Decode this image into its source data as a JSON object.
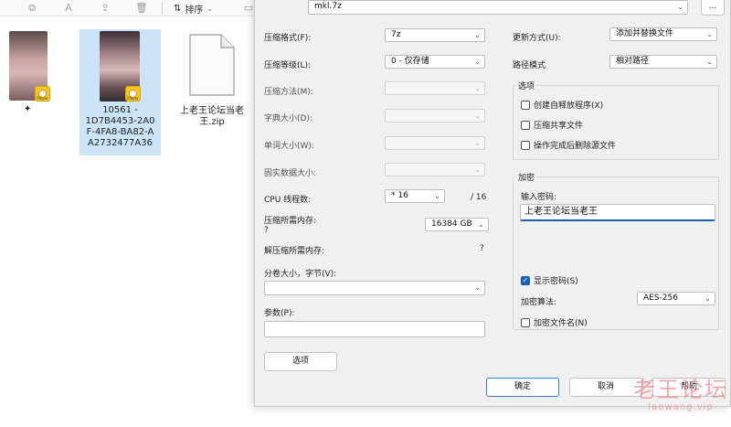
{
  "toolbar": {
    "sort_label": "排序",
    "icons": [
      "copy-icon",
      "rename-icon",
      "share-icon",
      "delete-icon"
    ]
  },
  "files": [
    {
      "name": "",
      "badge_text": "Player",
      "star_icon": "✦"
    },
    {
      "name": "10561 - 1D7B4453-2A0F-4FA8-BA82-AA2732477A36",
      "badge_text": "Player",
      "lines": [
        "10561 -",
        "1D7B4453-2A0",
        "F-4FA8-BA82-A",
        "A2732477A36"
      ]
    },
    {
      "name": "上老王论坛当老王.zip",
      "lines": [
        "上老王论坛当老",
        "王.zip"
      ]
    }
  ],
  "dialog": {
    "archive_field": {
      "value": "mkl.7z",
      "browse_label": "..."
    },
    "left": {
      "format": {
        "label": "压缩格式(F):",
        "value": "7z"
      },
      "level": {
        "label": "压缩等级(L):",
        "value": "0 - 仅存储"
      },
      "method": {
        "label": "压缩方法(M):",
        "value": ""
      },
      "dict": {
        "label": "字典大小(D):",
        "value": ""
      },
      "word": {
        "label": "单词大小(W):",
        "value": ""
      },
      "solid": {
        "label": "固实数据大小:",
        "value": ""
      },
      "cpu": {
        "label": "CPU 线程数:",
        "value": "* 16",
        "total": "/ 16"
      },
      "mem_compress": {
        "label": "压缩所需内存:",
        "q": "?",
        "value": "16384 GB"
      },
      "mem_decompress": {
        "label": "解压缩所需内存:",
        "value": "?"
      },
      "split": {
        "label": "分卷大小，字节(V):",
        "value": ""
      },
      "params": {
        "label": "参数(P):",
        "value": ""
      },
      "options_button": "选项"
    },
    "right": {
      "update_mode": {
        "label": "更新方式(U):",
        "value": "添加并替换文件"
      },
      "path_mode": {
        "label": "路径模式",
        "value": "相对路径"
      },
      "options_group": {
        "title": "选项",
        "sfx": {
          "label": "创建自释放程序(X)",
          "checked": false
        },
        "shared": {
          "label": "压缩共享文件",
          "checked": false
        },
        "delete_after": {
          "label": "操作完成后删除源文件",
          "checked": false
        }
      },
      "encryption_group": {
        "title": "加密",
        "password_label": "输入密码:",
        "password_value": "上老王论坛当老王",
        "show_password": {
          "label": "显示密码(S)",
          "checked": true
        },
        "method": {
          "label": "加密算法:",
          "value": "AES-256"
        },
        "encrypt_names": {
          "label": "加密文件名(N)",
          "checked": false
        }
      }
    },
    "buttons": {
      "ok": "确定",
      "cancel": "取消",
      "help": "帮助"
    }
  },
  "watermark": {
    "main": "老王论坛",
    "sub": "laowang.vip"
  }
}
